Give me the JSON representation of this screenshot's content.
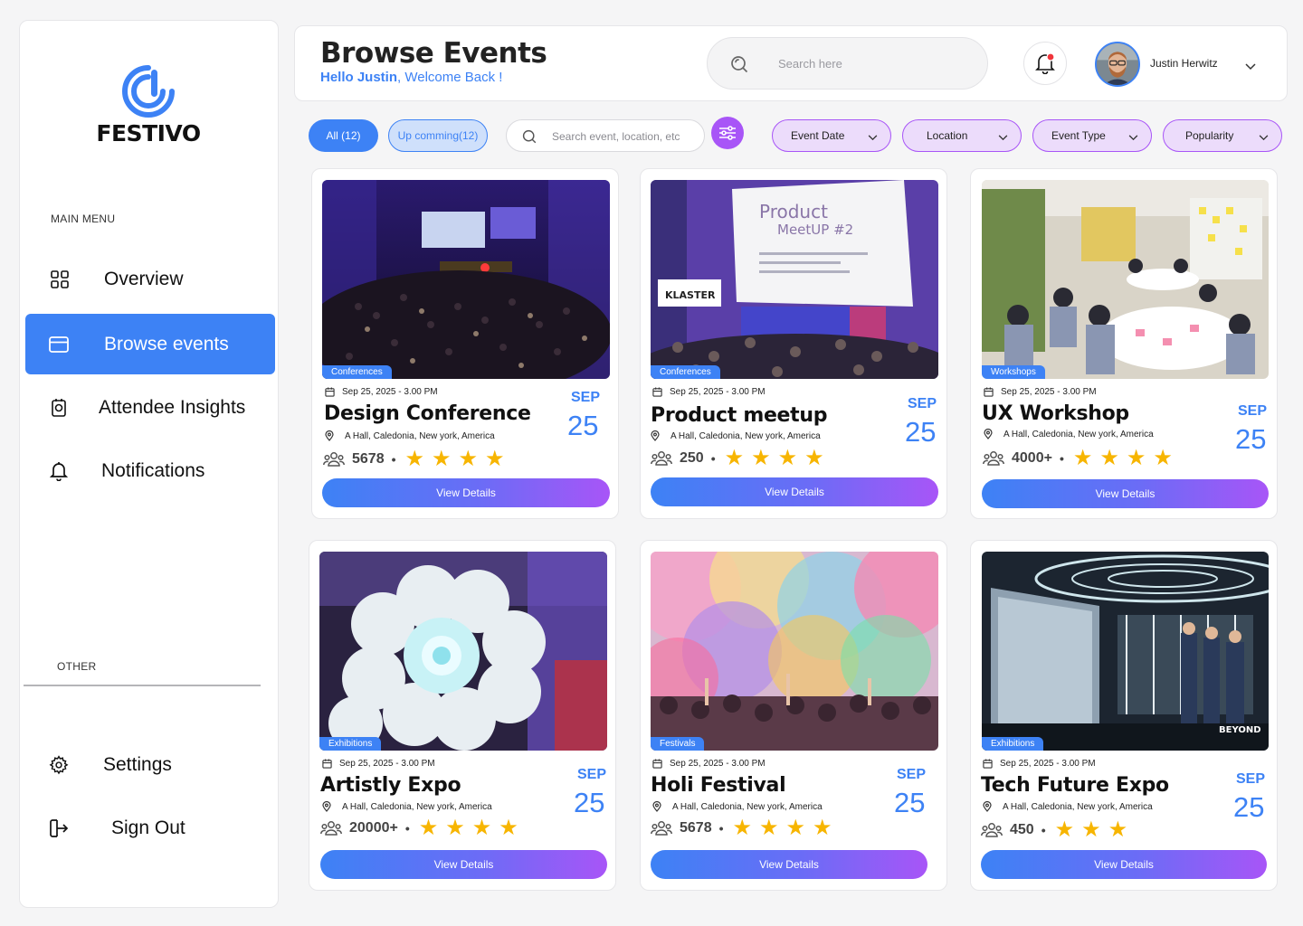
{
  "app": {
    "brand": "FESTIVO"
  },
  "sidebar": {
    "main_heading": "MAIN MENU",
    "other_heading": "OTHER",
    "items": [
      {
        "label": "Overview",
        "icon": "grid-icon"
      },
      {
        "label": "Browse events",
        "icon": "card-icon",
        "active": true
      },
      {
        "label": "Attendee Insights",
        "icon": "badge-icon"
      },
      {
        "label": "Notifications",
        "icon": "bell-icon"
      }
    ],
    "other_items": [
      {
        "label": "Settings",
        "icon": "gear-icon"
      },
      {
        "label": "Sign Out",
        "icon": "sign-out-icon"
      }
    ]
  },
  "header": {
    "title": "Browse Events",
    "greeting_name": "Hello Justin",
    "greeting_rest": ", Welcome Back !",
    "search_placeholder": "Search here",
    "user_name": "Justin Herwitz"
  },
  "filters": {
    "all_label": "All (12)",
    "upcoming_label": "Up comming(12)",
    "search_placeholder": "Search event, location, etc",
    "dropdowns": [
      "Event Date",
      "Location",
      "Event Type",
      "Popularity"
    ]
  },
  "colors": {
    "accent": "#3d82f5",
    "purple": "#a855f7",
    "star": "#f7b500"
  },
  "events": [
    {
      "title": "Design Conference",
      "tag": "Conferences",
      "date": "Sep 25, 2025 - 3.00 PM",
      "location": "A Hall, Caledonia, New york, America",
      "attendees": "5678",
      "stars": 4,
      "month": "SEP",
      "day": "25",
      "button": "View Details"
    },
    {
      "title": "Product meetup",
      "tag": "Conferences",
      "date": "Sep 25, 2025 - 3.00 PM",
      "location": "A Hall, Caledonia, New york, America",
      "attendees": "250",
      "stars": 4,
      "month": "SEP",
      "day": "25",
      "button": "View Details",
      "screen_text_1": "Product",
      "screen_text_2": "MeetUP #2",
      "banner_text": "KLASTER"
    },
    {
      "title": "UX Workshop",
      "tag": "Workshops",
      "date": "Sep 25, 2025 - 3.00 PM",
      "location": "A Hall, Caledonia, New york, America",
      "attendees": "4000+",
      "stars": 4,
      "month": "SEP",
      "day": "25",
      "button": "View Details"
    },
    {
      "title": "Artistly Expo",
      "tag": "Exhibitions",
      "date": "Sep 25, 2025 - 3.00 PM",
      "location": "A Hall, Caledonia, New york, America",
      "attendees": "20000+",
      "stars": 4,
      "month": "SEP",
      "day": "25",
      "button": "View Details"
    },
    {
      "title": "Holi Festival",
      "tag": "Festivals",
      "date": "Sep 25, 2025 - 3.00 PM",
      "location": "A Hall, Caledonia, New york, America",
      "attendees": "5678",
      "stars": 4,
      "month": "SEP",
      "day": "25",
      "button": "View Details"
    },
    {
      "title": "Tech Future Expo",
      "tag": "Exhibitions",
      "date": "Sep 25, 2025 - 3.00 PM",
      "location": "A Hall, Caledonia, New york, America",
      "attendees": "450",
      "stars": 3,
      "month": "SEP",
      "day": "25",
      "button": "View Details",
      "banner_text": "BEYOND"
    }
  ]
}
